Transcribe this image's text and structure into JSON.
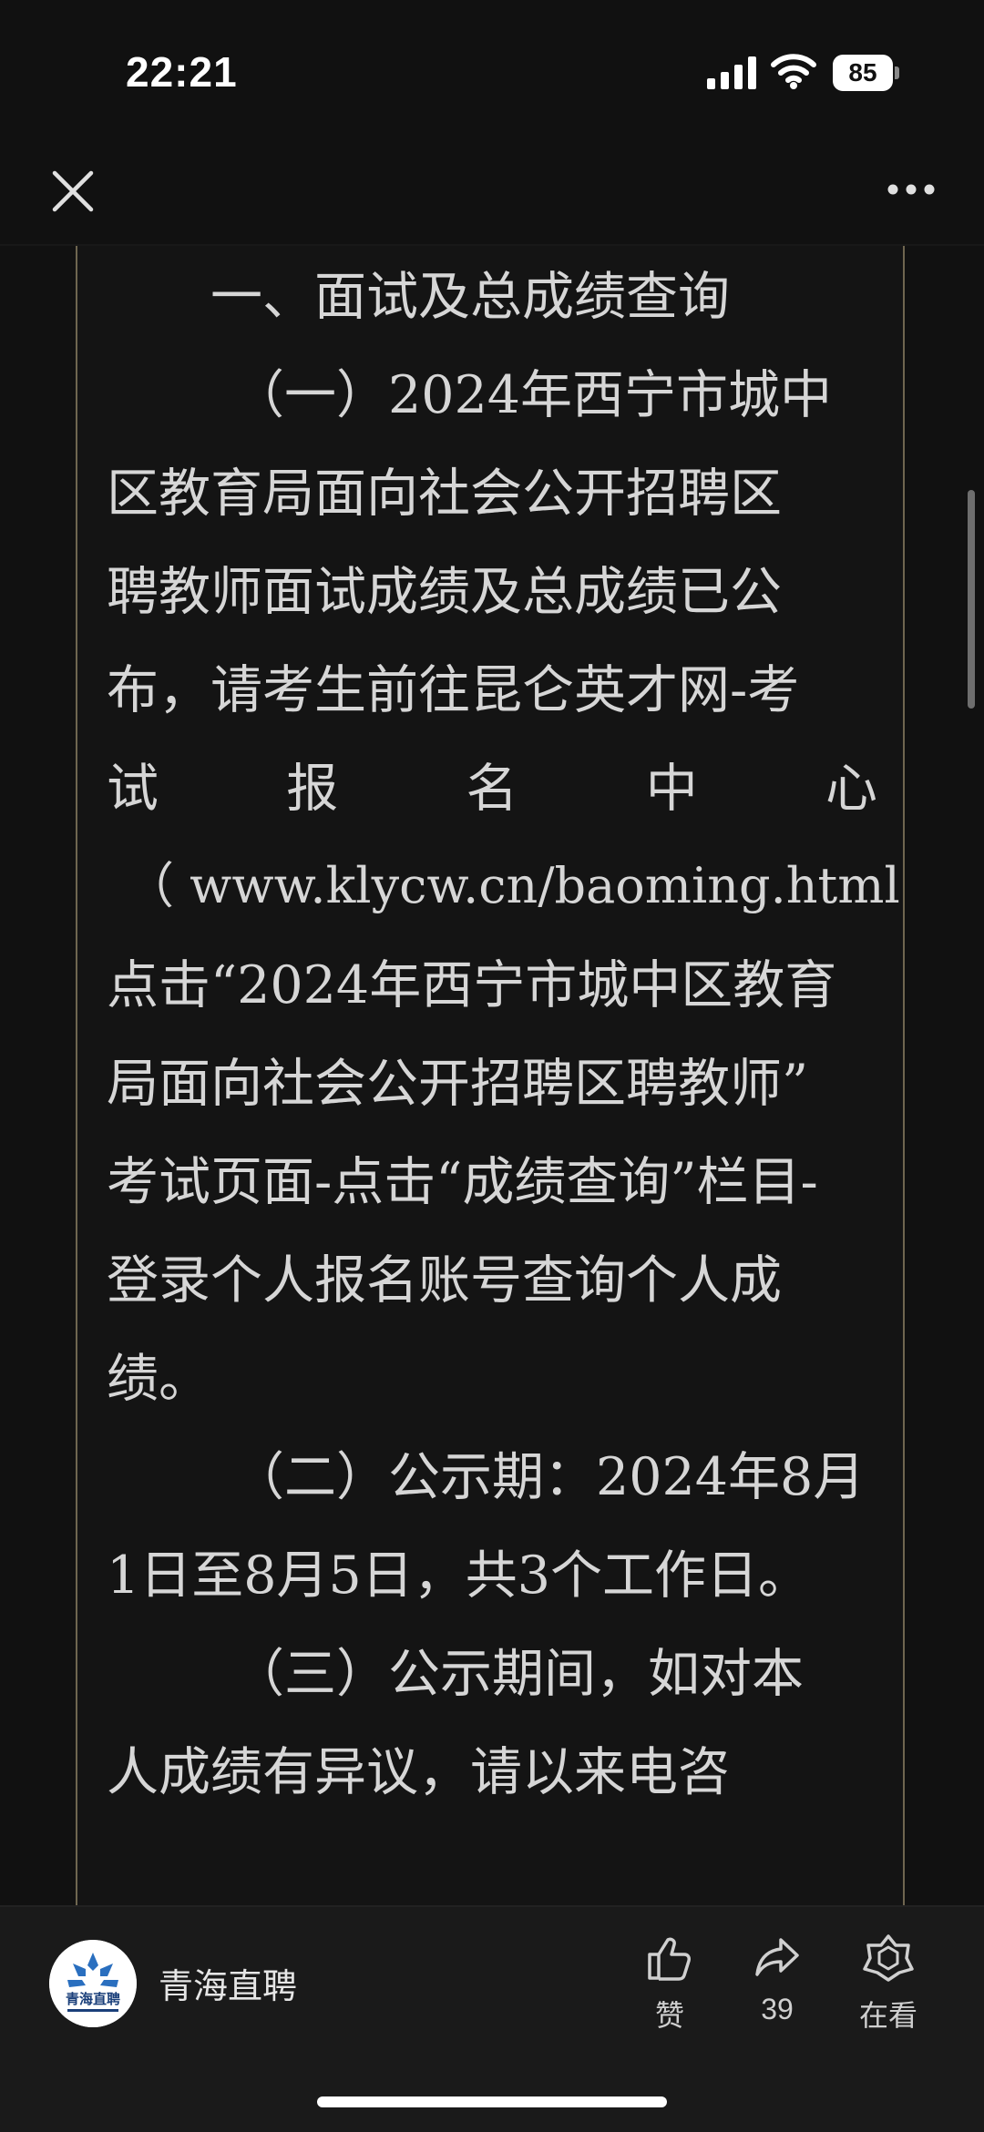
{
  "status_bar": {
    "time": "22:21",
    "battery": "85"
  },
  "article": {
    "lines": [
      "一、面试及总成绩查询",
      "（一）2024年西宁市城中",
      "区教育局面向社会公开招聘区",
      "聘教师面试成绩及总成绩已公",
      "布，请考生前往昆仑英才网-考",
      "（ www.klycw.cn/baoming.html)-",
      "点击“2024年西宁市城中区教育",
      "局面向社会公开招聘区聘教师”",
      "考试页面-点击“成绩查询”栏目-",
      "登录个人报名账号查询个人成",
      "绩。",
      "（二）公示期：2024年8月",
      "1日至8月5日，共3个工作日。",
      "（三）公示期间，如对本",
      "人成绩有异议，请以来电咨"
    ],
    "spaced_line": [
      "试",
      "报",
      "名",
      "中",
      "心"
    ]
  },
  "bottom_bar": {
    "account_name": "青海直聘",
    "avatar_text": "青海直聘",
    "like_label": "赞",
    "share_count": "39",
    "watching_label": "在看"
  },
  "icons": {
    "close": "close-icon",
    "more": "more-icon",
    "like": "thumbs-up-icon",
    "share": "share-arrow-icon",
    "watching": "watching-flower-icon"
  },
  "colors": {
    "background": "#111111",
    "article_border": "#6f6650",
    "text": "#d6d6d6"
  }
}
